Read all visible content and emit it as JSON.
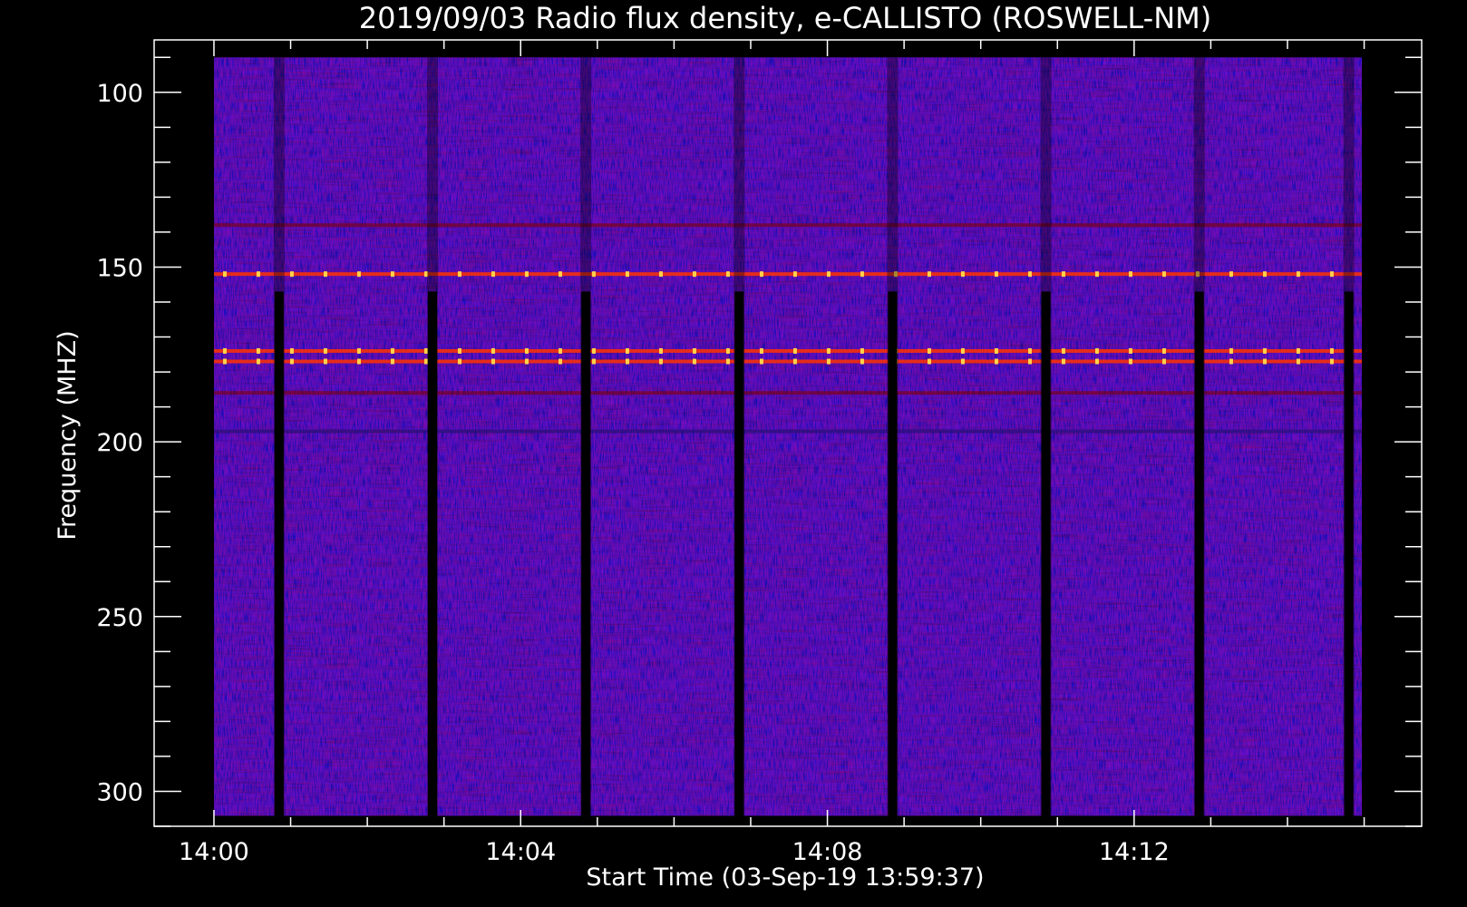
{
  "chart_data": {
    "type": "heatmap",
    "title": "2019/09/03  Radio flux density, e-CALLISTO (ROSWELL-NM)",
    "xlabel": "Start Time (03-Sep-19 13:59:37)",
    "ylabel": "Frequency (MHZ)",
    "x_ticks": [
      "14:00",
      "14:04",
      "14:08",
      "14:12"
    ],
    "x_tick_minutes": [
      0,
      4,
      8,
      12
    ],
    "x_range_minutes": [
      -0.78,
      15.75
    ],
    "data_x_range_minutes": [
      0,
      14.97
    ],
    "y_ticks": [
      100,
      150,
      200,
      250,
      300
    ],
    "ylim": [
      310,
      85
    ],
    "data_y_range": [
      90,
      307
    ],
    "y_inverted": true,
    "grid": false,
    "colormap": [
      "#000000",
      "#0000ff",
      "#800000",
      "#ff3300",
      "#ffd24a"
    ],
    "background_color": "#3a1fe0",
    "black_gap_times_min": [
      0.85,
      2.85,
      4.85,
      6.85,
      8.85,
      10.85,
      12.85,
      14.8
    ],
    "emission_lines_mhz": [
      {
        "freq": 152,
        "intensity": "high"
      },
      {
        "freq": 174,
        "intensity": "high"
      },
      {
        "freq": 177,
        "intensity": "high"
      },
      {
        "freq": 186,
        "intensity": "medium"
      },
      {
        "freq": 197,
        "intensity": "low"
      },
      {
        "freq": 138,
        "intensity": "medium"
      }
    ]
  }
}
